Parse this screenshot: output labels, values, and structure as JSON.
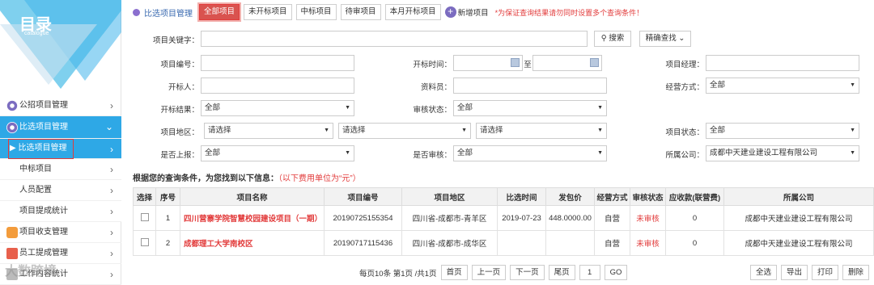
{
  "logo": {
    "title": "目录",
    "subtitle": "catalogue"
  },
  "sidebar": {
    "items": [
      {
        "label": "公招项目管理"
      },
      {
        "label": "比选项目管理"
      },
      {
        "label": "▶ 比选项目管理"
      },
      {
        "label": "中标项目"
      },
      {
        "label": "人员配置"
      },
      {
        "label": "项目提成统计"
      },
      {
        "label": "项目收支管理"
      },
      {
        "label": "员工提成管理"
      },
      {
        "label": "工作内容统计"
      }
    ]
  },
  "toolbar": {
    "title": "比选项目管理",
    "tabs": [
      "全部项目",
      "未开标项目",
      "中标项目",
      "待审项目",
      "本月开标项目"
    ],
    "new_label": "新增项目",
    "warning": "*为保证查询结果请勿同时设置多个查询条件！"
  },
  "search": {
    "keyword_label": "项目关键字：",
    "search_btn": "搜索",
    "precise_btn": "精确查找",
    "labels": {
      "code": "项目编号：",
      "open_time": "开标时间：",
      "to": "至",
      "manager": "项目经理：",
      "opener": "开标人：",
      "staff": "资料员：",
      "mode": "经营方式：",
      "result": "开标结果：",
      "audit": "审核状态：",
      "region": "项目地区：",
      "status": "项目状态：",
      "report": "是否上报：",
      "approved": "是否审核：",
      "company": "所属公司："
    },
    "values": {
      "mode": "全部",
      "result": "全部",
      "audit": "全部",
      "region1": "请选择",
      "region2": "请选择",
      "region3": "请选择",
      "status": "全部",
      "report": "全部",
      "approved": "全部",
      "company": "成都中天建业建设工程有限公司"
    }
  },
  "info": {
    "text": "根据您的查询条件，为您找到以下信息：",
    "unit": "（以下费用单位为“元”）"
  },
  "table": {
    "headers": [
      "选择",
      "序号",
      "项目名称",
      "项目编号",
      "项目地区",
      "比选时间",
      "发包价",
      "经营方式",
      "审核状态",
      "应收款(联营费)",
      "所属公司"
    ],
    "rows": [
      {
        "no": "1",
        "name": "四川营寨学院智慧校园建设项目（一期）",
        "code": "20190725155354",
        "region": "四川省-成都市-青羊区",
        "time": "2019-07-23",
        "price": "448.0000.00",
        "mode": "自营",
        "status": "未审核",
        "fee": "0",
        "company": "成都中天建业建设工程有限公司"
      },
      {
        "no": "2",
        "name": "成都理工大学南校区",
        "code": "20190717115436",
        "region": "四川省-成都市-成华区",
        "time": "",
        "price": "",
        "mode": "自营",
        "status": "未审核",
        "fee": "0",
        "company": "成都中天建业建设工程有限公司"
      }
    ]
  },
  "pager": {
    "info": "每页10条 第1页 /共1页",
    "first": "首页",
    "prev": "上一页",
    "next": "下一页",
    "last": "尾页",
    "page": "1",
    "go": "GO"
  },
  "actions": {
    "all": "全选",
    "export": "导出",
    "print": "打印",
    "delete": "删除"
  },
  "watermark": "大数跨境"
}
